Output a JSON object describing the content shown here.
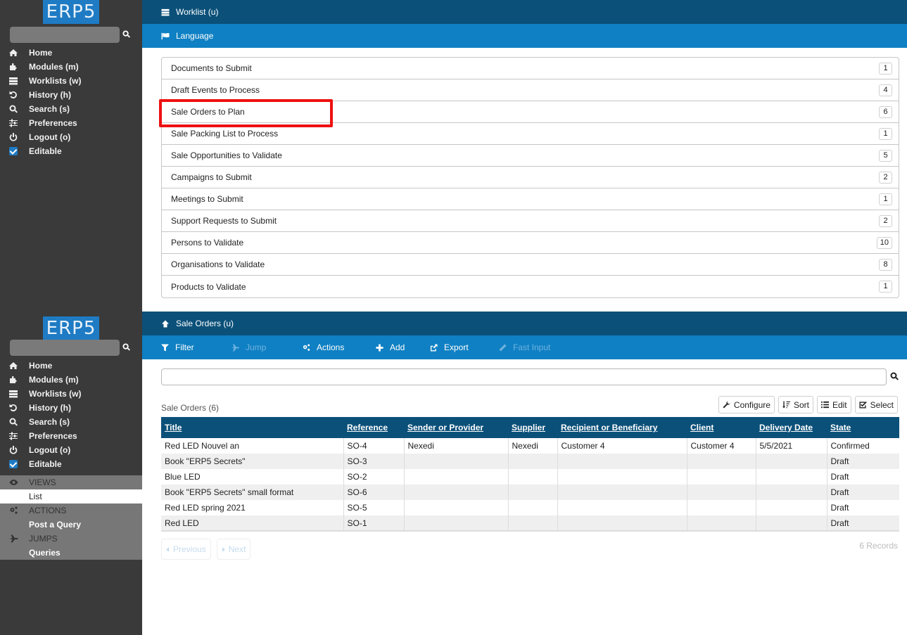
{
  "logo": "ERP5",
  "sidebar": {
    "search_placeholder": "",
    "items": [
      {
        "label": "Home",
        "icon": "home-icon"
      },
      {
        "label": "Modules (m)",
        "icon": "puzzle-icon"
      },
      {
        "label": "Worklists (w)",
        "icon": "tasks-icon"
      },
      {
        "label": "History (h)",
        "icon": "history-icon"
      },
      {
        "label": "Search (s)",
        "icon": "search-icon"
      },
      {
        "label": "Preferences",
        "icon": "sliders-icon"
      },
      {
        "label": "Logout (o)",
        "icon": "power-icon"
      },
      {
        "label": "Editable",
        "icon": "checkbox-icon",
        "checked": true
      }
    ],
    "panel": {
      "views_header": "VIEWS",
      "views": [
        "List"
      ],
      "actions_header": "ACTIONS",
      "actions": [
        "Post a Query"
      ],
      "jumps_header": "JUMPS",
      "jumps": [
        "Queries"
      ]
    }
  },
  "screen1": {
    "header_title": "Worklist (u)",
    "subheader_title": "Language",
    "worklist": [
      {
        "label": "Documents to Submit",
        "count": "1"
      },
      {
        "label": "Draft Events to Process",
        "count": "4"
      },
      {
        "label": "Sale Orders to Plan",
        "count": "6",
        "highlighted": true
      },
      {
        "label": "Sale Packing List to Process",
        "count": "1"
      },
      {
        "label": "Sale Opportunities to Validate",
        "count": "5"
      },
      {
        "label": "Campaigns to Submit",
        "count": "2"
      },
      {
        "label": "Meetings to Submit",
        "count": "1"
      },
      {
        "label": "Support Requests to Submit",
        "count": "2"
      },
      {
        "label": "Persons to Validate",
        "count": "10"
      },
      {
        "label": "Organisations to Validate",
        "count": "8"
      },
      {
        "label": "Products to Validate",
        "count": "1"
      }
    ],
    "highlight_color": "#ee1111"
  },
  "screen2": {
    "header_title": "Sale Orders (u)",
    "toolbar": {
      "filter": "Filter",
      "jump": "Jump",
      "actions": "Actions",
      "add": "Add",
      "export": "Export",
      "fast_input": "Fast Input"
    },
    "search_value": "",
    "list_title": "Sale Orders (6)",
    "list_buttons": {
      "configure": "Configure",
      "sort": "Sort",
      "edit": "Edit",
      "select": "Select"
    },
    "columns": [
      "Title",
      "Reference",
      "Sender or Provider",
      "Supplier",
      "Recipient or Beneficiary",
      "Client",
      "Delivery Date",
      "State"
    ],
    "rows": [
      [
        "Red LED Nouvel an",
        "SO-4",
        "Nexedi",
        "Nexedi",
        "Customer 4",
        "Customer 4",
        "5/5/2021",
        "Confirmed"
      ],
      [
        "Book \"ERP5 Secrets\"",
        "SO-3",
        "",
        "",
        "",
        "",
        "",
        "Draft"
      ],
      [
        "Blue LED",
        "SO-2",
        "",
        "",
        "",
        "",
        "",
        "Draft"
      ],
      [
        "Book \"ERP5 Secrets\" small format",
        "SO-6",
        "",
        "",
        "",
        "",
        "",
        "Draft"
      ],
      [
        "Red LED spring 2021",
        "SO-5",
        "",
        "",
        "",
        "",
        "",
        "Draft"
      ],
      [
        "Red LED",
        "SO-1",
        "",
        "",
        "",
        "",
        "",
        "Draft"
      ]
    ],
    "pager": {
      "previous": "Previous",
      "next": "Next"
    },
    "records": "6 Records"
  },
  "colors": {
    "topbar": "#0b5079",
    "subbar": "#0f80c3",
    "sidebar": "#3a3a3a",
    "logo": "#1e7bc4"
  }
}
